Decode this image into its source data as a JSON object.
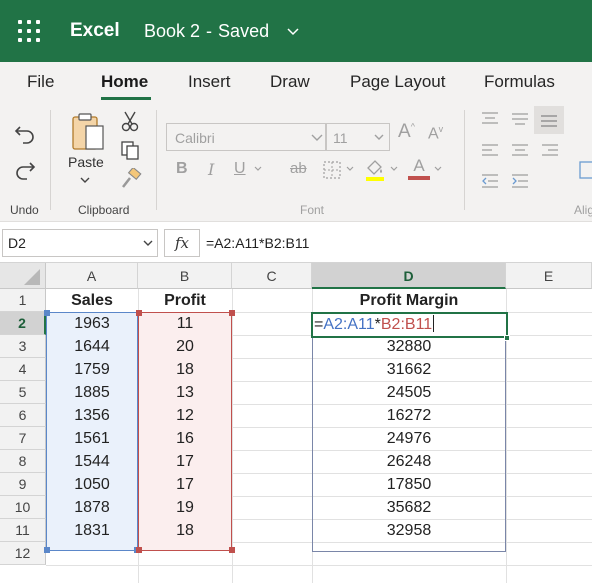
{
  "titlebar": {
    "app_name": "Excel",
    "document": "Book 2",
    "separator": "-",
    "save_status": "Saved"
  },
  "tabs": [
    {
      "label": "File"
    },
    {
      "label": "Home",
      "active": true
    },
    {
      "label": "Insert"
    },
    {
      "label": "Draw"
    },
    {
      "label": "Page Layout"
    },
    {
      "label": "Formulas"
    }
  ],
  "ribbon": {
    "undo_group_label": "Undo",
    "clipboard_group_label": "Clipboard",
    "font_group_label": "Font",
    "alignment_group_label": "Alig",
    "paste_label": "Paste",
    "font_name": "Calibri",
    "font_size": "11",
    "bold_glyph": "B",
    "italic_glyph": "I",
    "underline_glyph": "U",
    "strike_glyph": "ab",
    "grow_glyph": "A",
    "shrink_glyph": "A",
    "font_color_glyph": "A",
    "font_color": "#c0504d",
    "highlight_color": "#ffff00"
  },
  "formula_bar": {
    "name_box": "D2",
    "fx_label": "fx",
    "formula": "=A2:A11*B2:B11"
  },
  "sheet": {
    "columns": [
      "A",
      "B",
      "C",
      "D",
      "E"
    ],
    "rows": [
      "1",
      "2",
      "3",
      "4",
      "5",
      "6",
      "7",
      "8",
      "9",
      "10",
      "11",
      "12"
    ],
    "headers": {
      "A1": "Sales",
      "B1": "Profit",
      "D1": "Profit Margin"
    },
    "sales": [
      "1963",
      "1644",
      "1759",
      "1885",
      "1356",
      "1561",
      "1544",
      "1050",
      "1878",
      "1831"
    ],
    "profit": [
      "11",
      "20",
      "18",
      "13",
      "12",
      "16",
      "17",
      "17",
      "19",
      "18"
    ],
    "margin": [
      "32880",
      "31662",
      "24505",
      "16272",
      "24976",
      "26248",
      "17850",
      "35682",
      "32958"
    ],
    "active_cell": {
      "eq": "=",
      "ref_a": "A2:A11",
      "op": "*",
      "ref_b": "B2:B11"
    },
    "ref_a_color": "#4472c4",
    "ref_b_color": "#c0504d",
    "accent": "#217346"
  }
}
